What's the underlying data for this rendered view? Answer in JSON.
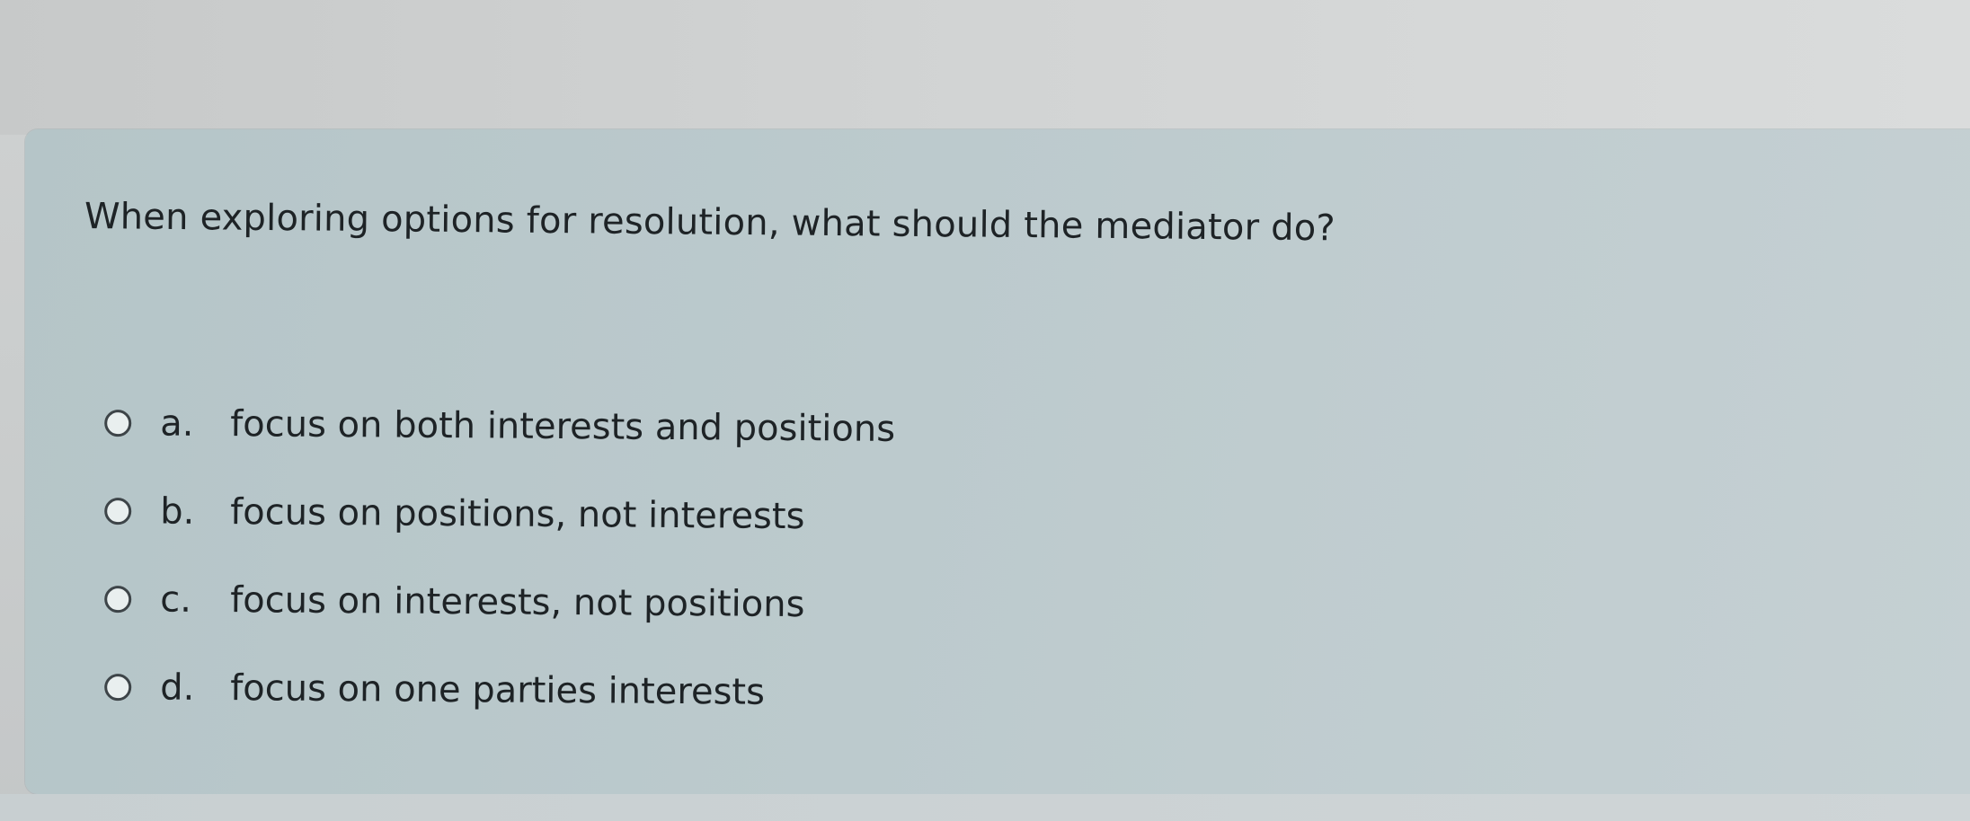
{
  "question": {
    "text": "When exploring options for resolution, what should the mediator do?"
  },
  "answers": [
    {
      "letter": "a.",
      "text": "focus on both interests and positions",
      "selected": false
    },
    {
      "letter": "b.",
      "text": "focus on positions, not interests",
      "selected": false
    },
    {
      "letter": "c.",
      "text": "focus on interests, not positions",
      "selected": false
    },
    {
      "letter": "d.",
      "text": "focus on one parties interests",
      "selected": false
    }
  ],
  "colors": {
    "card_background": "#bccacd",
    "text": "#1e2326",
    "radio_border": "#3d4448"
  }
}
